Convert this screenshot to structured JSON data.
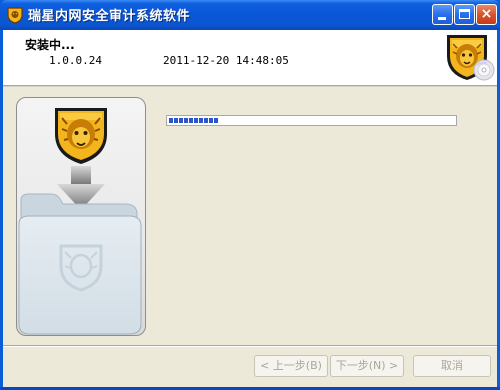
{
  "window": {
    "title": "瑞星内网安全审计系统软件",
    "icon": "rising-lion-icon",
    "controls": {
      "minimize": "minimize-icon",
      "maximize": "maximize-icon",
      "close": "close-icon",
      "close_glyph": "×"
    }
  },
  "header": {
    "title": "安装中...",
    "version": "1.0.0.24",
    "datetime": "2011-12-20 14:48:05",
    "logo": "rising-lion-shield-logo"
  },
  "progress": {
    "value": 0.19,
    "segments": 10,
    "color": "#2b55c8"
  },
  "buttons": {
    "back": "< 上一步(B)",
    "next": "下一步(N) >",
    "cancel": "取消",
    "enabled": false
  },
  "colors": {
    "titlebar": "#0a57d6",
    "dialog_bg": "#ece9d8",
    "shield_gold": "#f2b51d"
  }
}
